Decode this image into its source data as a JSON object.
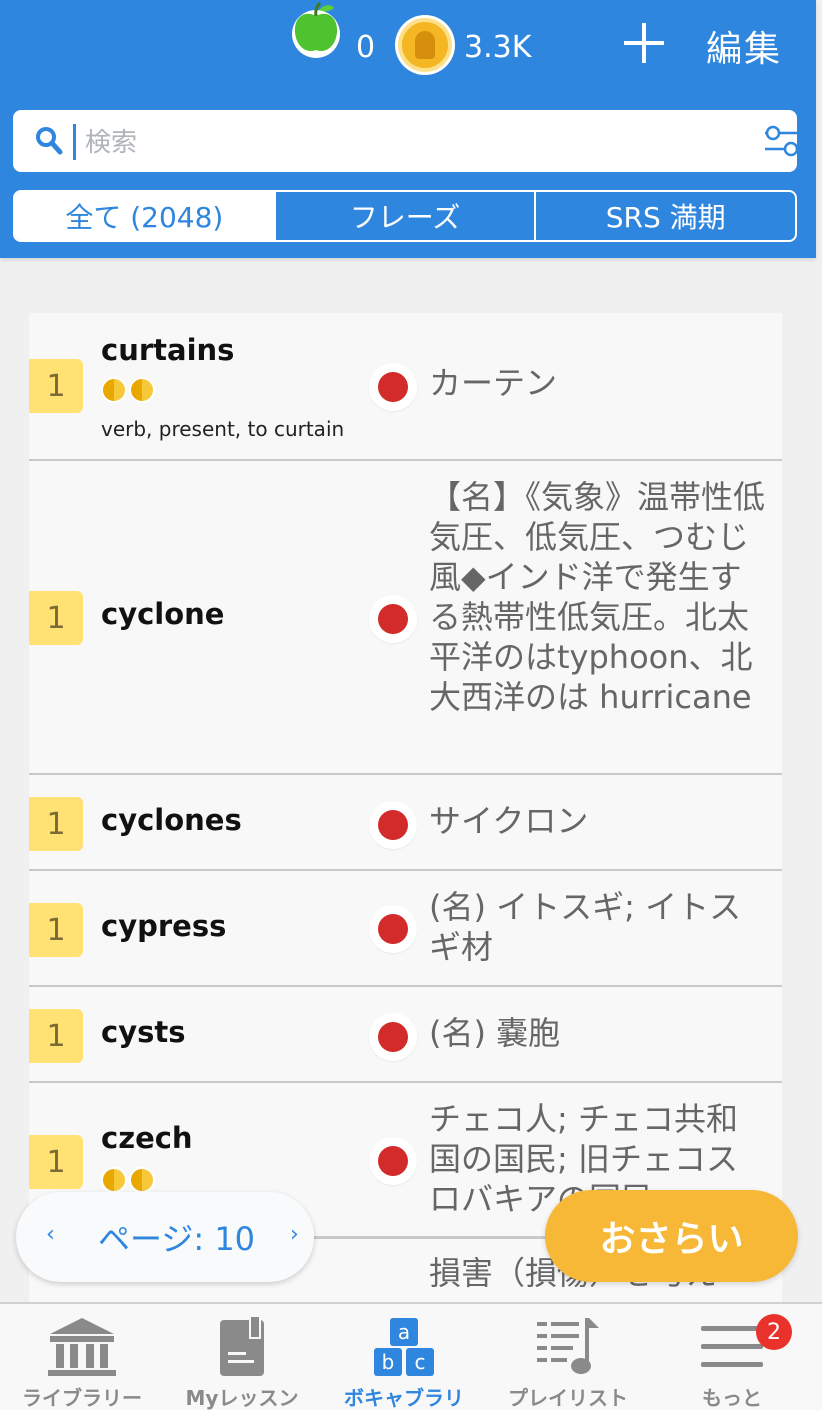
{
  "header": {
    "apples": "0",
    "coins": "3.3K",
    "edit_label": "編集"
  },
  "search": {
    "placeholder": "検索"
  },
  "tabs": [
    {
      "label": "全て (2048)",
      "active": true
    },
    {
      "label": "フレーズ",
      "active": false
    },
    {
      "label": "SRS 満期",
      "active": false
    }
  ],
  "words": [
    {
      "level": "1",
      "word": "curtains",
      "coins": 2,
      "sub": "verb, present, to curtain",
      "definition": "カーテン"
    },
    {
      "level": "1",
      "word": "cyclone",
      "coins": 0,
      "sub": "",
      "definition": "【名】《気象》温帯性低気圧、低気圧、つむじ風◆インド洋で発生する熱帯性低気圧。北太平洋のはtyphoon、北大西洋のは hurricane"
    },
    {
      "level": "1",
      "word": "cyclones",
      "coins": 0,
      "sub": "",
      "definition": "サイクロン"
    },
    {
      "level": "1",
      "word": "cypress",
      "coins": 0,
      "sub": "",
      "definition": "(名) イトスギ; イトスギ材"
    },
    {
      "level": "1",
      "word": "cysts",
      "coins": 0,
      "sub": "",
      "definition": "(名) 嚢胞"
    },
    {
      "level": "1",
      "word": "czech",
      "coins": 2,
      "sub": "",
      "definition": "チェコ人; チェコ共和国の国民; 旧チェコスロバキアの国民"
    },
    {
      "level": "",
      "word": "",
      "coins": 0,
      "sub": "",
      "definition": "損害（損傷）を与え"
    }
  ],
  "pager": {
    "label": "ページ: 10",
    "prev": "‹",
    "next": "›"
  },
  "review_label": "おさらい",
  "nav": {
    "items": [
      {
        "label": "ライブラリー",
        "icon": "library-icon"
      },
      {
        "label": "Myレッスン",
        "icon": "lesson-book-icon"
      },
      {
        "label": "ボキャブラリ",
        "icon": "abc-blocks-icon",
        "active": true
      },
      {
        "label": "プレイリスト",
        "icon": "playlist-icon"
      },
      {
        "label": "もっと",
        "icon": "menu-icon"
      }
    ],
    "badge": "2"
  },
  "colors": {
    "primary": "#2f86de",
    "level_badge": "#ffe273",
    "status_dot": "#d32a2a",
    "review_button": "#f6b836"
  }
}
